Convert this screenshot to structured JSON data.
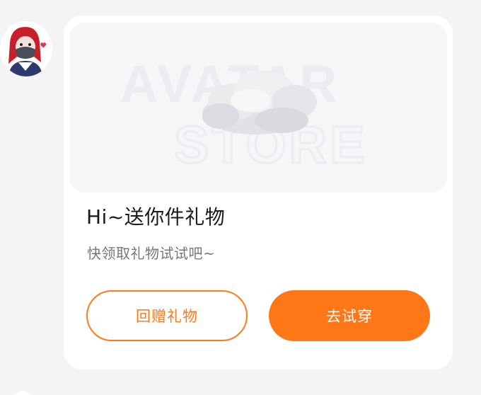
{
  "avatar": {
    "icon": "user-avatar-illustration"
  },
  "banner": {
    "line1": "AVATAR",
    "line2": "STORE",
    "icon": "cloud-icon"
  },
  "message": {
    "title": "Hi~送你件礼物",
    "subtitle": "快领取礼物试试吧~"
  },
  "actions": {
    "return_gift_label": "回赠礼物",
    "try_on_label": "去试穿"
  },
  "colors": {
    "accent": "#ff7716",
    "background": "#f4f4f6",
    "card": "#ffffff"
  }
}
